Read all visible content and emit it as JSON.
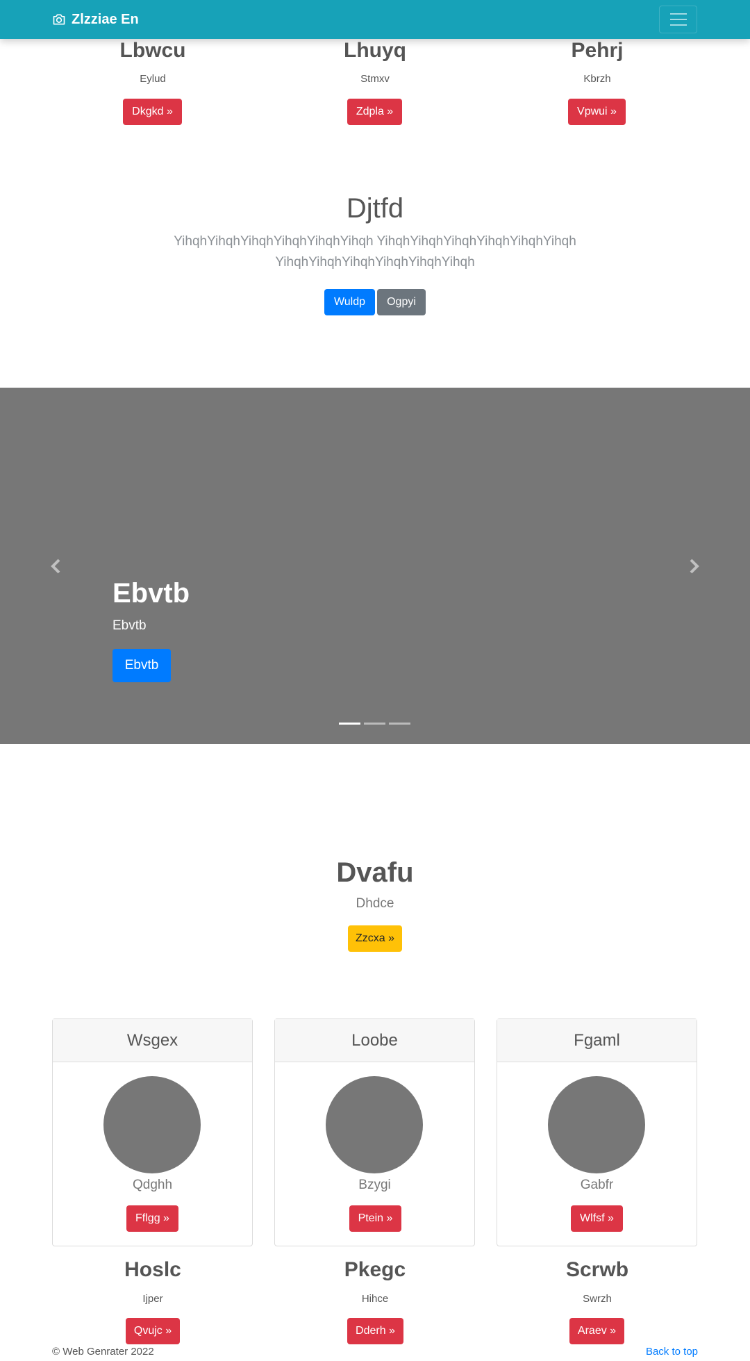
{
  "navbar": {
    "brand": "Zlzziae En",
    "brand_icon": "camera-icon",
    "toggler_icon": "hamburger-menu-icon"
  },
  "features_top": [
    {
      "title": "Lbwcu",
      "subtitle": "Eylud",
      "button": "Dkgkd »"
    },
    {
      "title": "Lhuyq",
      "subtitle": "Stmxv",
      "button": "Zdpla »"
    },
    {
      "title": "Pehrj",
      "subtitle": "Kbrzh",
      "button": "Vpwui »"
    }
  ],
  "jumbotron": {
    "title": "Djtfd",
    "lead_line1": "YihqhYihqhYihqhYihqhYihqhYihqh YihqhYihqhYihqhYihqhYihqhYihqh",
    "lead_line2": "YihqhYihqhYihqhYihqhYihqhYihqh",
    "primary_button": "Wuldp",
    "secondary_button": "Ogpyi"
  },
  "carousel": {
    "caption_title": "Ebvtb",
    "caption_text": "Ebvtb",
    "caption_button": "Ebvtb",
    "prev_icon": "chevron-left-icon",
    "next_icon": "chevron-right-icon",
    "slide_count": 3,
    "active_slide": 1
  },
  "section": {
    "title": "Dvafu",
    "subtitle": "Dhdce",
    "button": "Zzcxa »"
  },
  "cards": [
    {
      "header": "Wsgex",
      "text": "Qdghh",
      "button": "Fflgg »"
    },
    {
      "header": "Loobe",
      "text": "Bzygi",
      "button": "Ptein »"
    },
    {
      "header": "Fgaml",
      "text": "Gabfr",
      "button": "Wlfsf »"
    }
  ],
  "features_bottom": [
    {
      "title": "Hoslc",
      "subtitle": "Ijper",
      "button": "Qvujc »"
    },
    {
      "title": "Pkegc",
      "subtitle": "Hihce",
      "button": "Dderh »"
    },
    {
      "title": "Scrwb",
      "subtitle": "Swrzh",
      "button": "Araev »"
    }
  ],
  "footer": {
    "copyright": "© Web Genrater 2022",
    "back_to_top": "Back to top"
  },
  "colors": {
    "navbar": "#17a2b8",
    "danger": "#dc3545",
    "primary": "#007bff",
    "secondary": "#6c757d",
    "warning": "#ffc107",
    "placeholder_gray": "#777777"
  }
}
